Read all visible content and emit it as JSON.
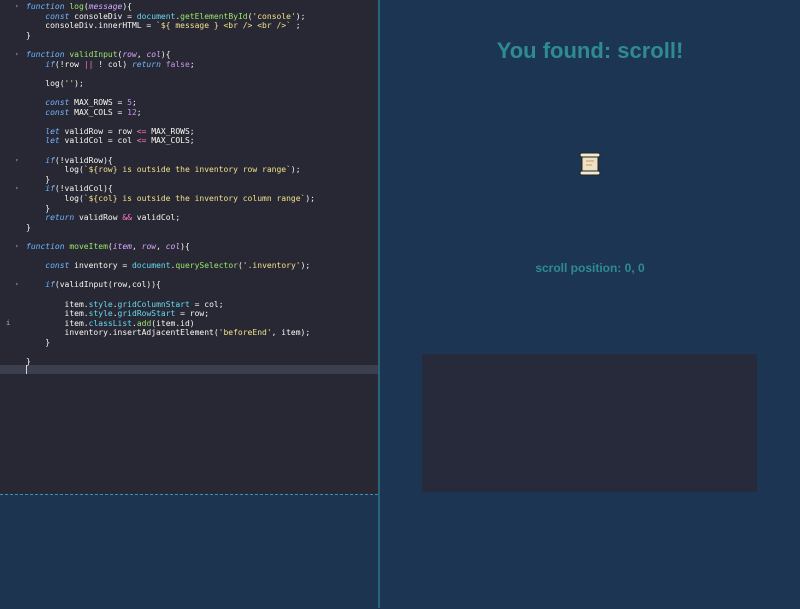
{
  "editor": {
    "lines": [
      "<span class=\"k\">function</span> <span class=\"f\">log</span>(<span class=\"p\">message</span>){",
      "    <span class=\"k\">const</span> consoleDiv = <span class=\"ap\">document</span>.<span class=\"f\">getElementById</span>(<span class=\"s\">'console'</span>);",
      "    consoleDiv.innerHTML = <span class=\"s\">`${ message } &lt;br /&gt; &lt;br /&gt;`</span> ;",
      "}",
      "",
      "<span class=\"k\">function</span> <span class=\"f\">validInput</span>(<span class=\"p\">row</span>, <span class=\"p\">col</span>){",
      "    <span class=\"k\">if</span>(!row <span class=\"o\">||</span> ! col) <span class=\"k\">return</span> <span class=\"n\">false</span>;",
      "",
      "    log(<span class=\"s\">''</span>);",
      "",
      "    <span class=\"k\">const</span> MAX_ROWS = <span class=\"n\">5</span>;",
      "    <span class=\"k\">const</span> MAX_COLS = <span class=\"n\">12</span>;",
      "",
      "    <span class=\"k\">let</span> validRow = row <span class=\"o\">&lt;=</span> MAX_ROWS;",
      "    <span class=\"k\">let</span> validCol = col <span class=\"o\">&lt;=</span> MAX_COLS;",
      "",
      "    <span class=\"k\">if</span>(!validRow){",
      "        log(<span class=\"s\">`${row} is outside the inventory row range`</span>);",
      "    }",
      "    <span class=\"k\">if</span>(!validCol){",
      "        log(<span class=\"s\">`${col} is outside the inventory column range`</span>);",
      "    }",
      "    <span class=\"k\">return</span> validRow <span class=\"o\">&amp;&amp;</span> validCol;",
      "}",
      "",
      "<span class=\"k\">function</span> <span class=\"f\">moveItem</span>(<span class=\"p\">item</span>, <span class=\"p\">row</span>, <span class=\"p\">col</span>){",
      "",
      "    <span class=\"k\">const</span> inventory = <span class=\"ap\">document</span>.<span class=\"f\">querySelector</span>(<span class=\"s\">'.inventory'</span>);",
      "",
      "    <span class=\"k\">if</span>(validInput(row,col)){",
      "",
      "        item.<span class=\"ap\">style</span>.<span class=\"ap\">gridColumnStart</span> = col;",
      "        item.<span class=\"ap\">style</span>.<span class=\"ap\">gridRowStart</span> = row;",
      "        item.<span class=\"ap\">classList</span>.<span class=\"f\">add</span>(item.id)",
      "        inventory.insertAdjacentElement(<span class=\"s\">'beforeEnd'</span>, item);",
      "    }",
      "",
      "}"
    ]
  },
  "preview": {
    "found_text": "You found: scroll!",
    "position_text": "scroll position: 0, 0",
    "item_icon": "scroll-icon"
  }
}
